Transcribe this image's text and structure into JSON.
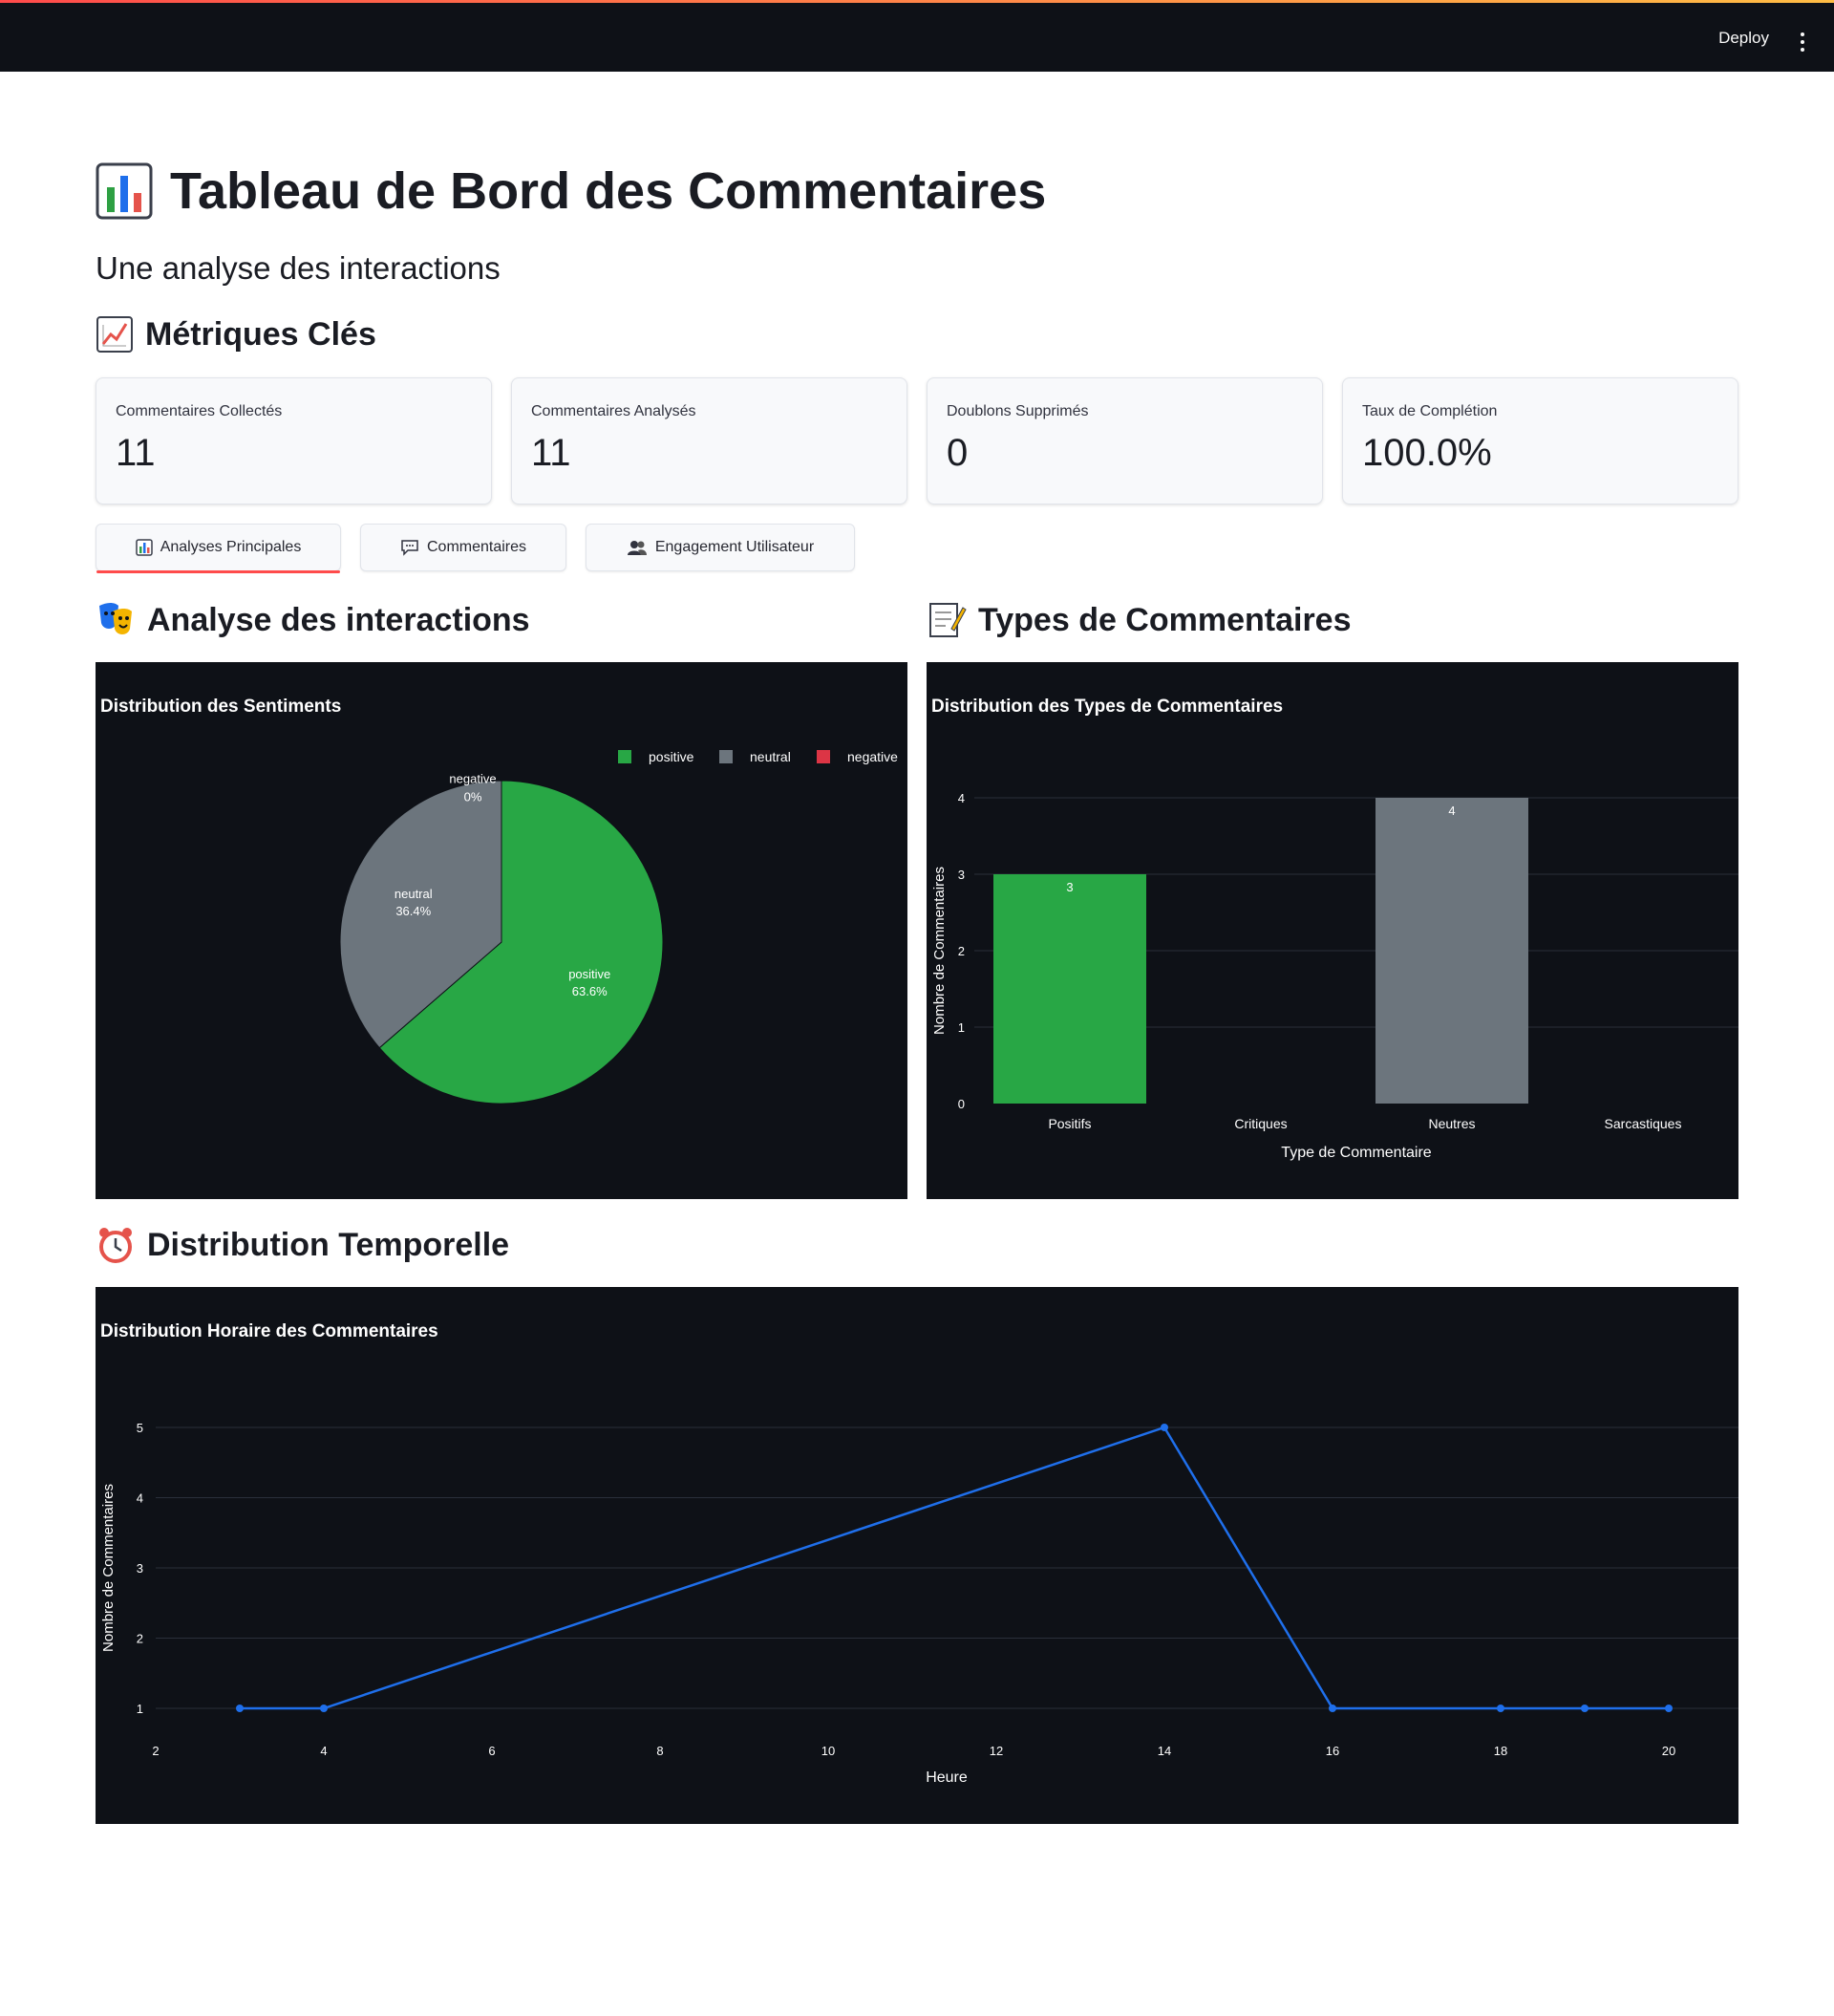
{
  "header": {
    "deploy_label": "Deploy",
    "menu_icon": "kebab-menu-icon"
  },
  "page": {
    "title": "Tableau de Bord des Commentaires",
    "title_icon": "bar-chart-emoji-icon",
    "subtitle": "Une analyse des interactions"
  },
  "metrics_section": {
    "title": "Métriques Clés",
    "icon": "chart-increasing-emoji-icon",
    "cards": [
      {
        "label": "Commentaires Collectés",
        "value": "11"
      },
      {
        "label": "Commentaires Analysés",
        "value": "11"
      },
      {
        "label": "Doublons Supprimés",
        "value": "0"
      },
      {
        "label": "Taux de Complétion",
        "value": "100.0%"
      }
    ]
  },
  "tabs": [
    {
      "label": "Analyses Principales",
      "icon": "bar-chart-emoji-icon",
      "active": true
    },
    {
      "label": "Commentaires",
      "icon": "speech-bubble-icon",
      "active": false
    },
    {
      "label": "Engagement Utilisateur",
      "icon": "users-icon",
      "active": false
    }
  ],
  "sections": {
    "interactions": {
      "title": "Analyse des interactions",
      "icon": "performing-arts-emoji-icon"
    },
    "types": {
      "title": "Types de Commentaires",
      "icon": "memo-emoji-icon"
    },
    "temporal": {
      "title": "Distribution Temporelle",
      "icon": "alarm-clock-emoji-icon"
    }
  },
  "colors": {
    "positive": "#28a745",
    "neutral": "#6c757d",
    "negative": "#dc3545",
    "line": "#1f6feb",
    "panel_bg": "#0e1117",
    "accent": "#ff4b4b"
  },
  "chart_data": [
    {
      "type": "pie",
      "title": "Distribution des Sentiments",
      "labels": [
        "positive",
        "neutral",
        "negative"
      ],
      "values": [
        7,
        4,
        0
      ],
      "percent_labels": [
        "63.6%",
        "36.4%",
        "0%"
      ],
      "legend": [
        "positive",
        "neutral",
        "negative"
      ],
      "legend_position": "top-right"
    },
    {
      "type": "bar",
      "title": "Distribution des Types de Commentaires",
      "categories": [
        "Positifs",
        "Critiques",
        "Neutres",
        "Sarcastiques"
      ],
      "values": [
        3,
        0,
        4,
        0
      ],
      "data_labels": [
        "3",
        "",
        "4",
        ""
      ],
      "xlabel": "Type de Commentaire",
      "ylabel": "Nombre de Commentaires",
      "ylim": [
        0,
        4
      ],
      "yticks": [
        "0",
        "1",
        "2",
        "3",
        "4"
      ],
      "grid": true
    },
    {
      "type": "line",
      "title": "Distribution Horaire des Commentaires",
      "x": [
        3,
        4,
        14,
        16,
        18,
        19,
        20
      ],
      "y": [
        1,
        1,
        5,
        1,
        1,
        1,
        1
      ],
      "xlabel": "Heure",
      "ylabel": "Nombre de Commentaires",
      "xlim": [
        2,
        21
      ],
      "ylim": [
        0.5,
        5.3
      ],
      "xticks": [
        "2",
        "4",
        "6",
        "8",
        "10",
        "12",
        "14",
        "16",
        "18",
        "20"
      ],
      "yticks": [
        "1",
        "2",
        "3",
        "4",
        "5"
      ],
      "grid": true
    }
  ]
}
